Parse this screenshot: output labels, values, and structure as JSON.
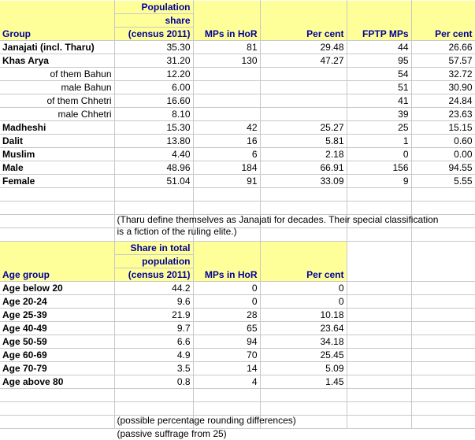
{
  "table_ethnic": {
    "headers": [
      "Group",
      "Population share\n(census 2011)",
      "MPs in HoR",
      "Per cent",
      "FPTP MPs",
      "Per cent"
    ],
    "header_parts": {
      "group": "Group",
      "population_share_l1": "Population",
      "population_share_l2": "share",
      "population_share_l3": "(census 2011)",
      "mps_in_hor": "MPs in HoR",
      "per_cent_1": "Per cent",
      "fptp_mps": "FPTP MPs",
      "per_cent_2": "Per cent"
    },
    "rows": [
      {
        "label": "Janajati (incl. Tharu)",
        "style": "bold",
        "pop_share": "35.30",
        "mps_hor": "81",
        "pct_hor": "29.48",
        "fptp": "44",
        "pct_fptp": "26.66"
      },
      {
        "label": "Khas Arya",
        "style": "bold",
        "pop_share": "31.20",
        "mps_hor": "130",
        "pct_hor": "47.27",
        "fptp": "95",
        "pct_fptp": "57.57"
      },
      {
        "label": "of them Bahun",
        "style": "indent",
        "pop_share": "12.20",
        "mps_hor": "",
        "pct_hor": "",
        "fptp": "54",
        "pct_fptp": "32.72"
      },
      {
        "label": "male Bahun",
        "style": "indent",
        "pop_share": "6.00",
        "mps_hor": "",
        "pct_hor": "",
        "fptp": "51",
        "pct_fptp": "30.90"
      },
      {
        "label": "of them Chhetri",
        "style": "indent",
        "pop_share": "16.60",
        "mps_hor": "",
        "pct_hor": "",
        "fptp": "41",
        "pct_fptp": "24.84"
      },
      {
        "label": "male Chhetri",
        "style": "indent",
        "pop_share": "8.10",
        "mps_hor": "",
        "pct_hor": "",
        "fptp": "39",
        "pct_fptp": "23.63"
      },
      {
        "label": "Madheshi",
        "style": "bold",
        "pop_share": "15.30",
        "mps_hor": "42",
        "pct_hor": "25.27",
        "fptp": "25",
        "pct_fptp": "15.15"
      },
      {
        "label": "Dalit",
        "style": "bold",
        "pop_share": "13.80",
        "mps_hor": "16",
        "pct_hor": "5.81",
        "fptp": "1",
        "pct_fptp": "0.60"
      },
      {
        "label": "Muslim",
        "style": "bold",
        "pop_share": "4.40",
        "mps_hor": "6",
        "pct_hor": "2.18",
        "fptp": "0",
        "pct_fptp": "0.00"
      },
      {
        "label": "Male",
        "style": "bold",
        "pop_share": "48.96",
        "mps_hor": "184",
        "pct_hor": "66.91",
        "fptp": "156",
        "pct_fptp": "94.55"
      },
      {
        "label": "Female",
        "style": "bold",
        "pop_share": "51.04",
        "mps_hor": "91",
        "pct_hor": "33.09",
        "fptp": "9",
        "pct_fptp": "5.55"
      }
    ]
  },
  "note_tharu": "(Tharu define themselves as Janajati for decades. Their special classification\nis a fiction of the ruling elite.)",
  "table_age": {
    "header_parts": {
      "age_group": "Age group",
      "share_l1": "Share in total",
      "share_l2": "population",
      "share_l3": "(census 2011)",
      "mps_in_hor": "MPs in HoR",
      "per_cent": "Per cent"
    },
    "rows": [
      {
        "label": "Age  below 20",
        "pop_share": "44.2",
        "mps_hor": "0",
        "pct_hor": "0"
      },
      {
        "label": "Age 20-24",
        "pop_share": "9.6",
        "mps_hor": "0",
        "pct_hor": "0"
      },
      {
        "label": "Age 25-39",
        "pop_share": "21.9",
        "mps_hor": "28",
        "pct_hor": "10.18"
      },
      {
        "label": "Age 40-49",
        "pop_share": "9.7",
        "mps_hor": "65",
        "pct_hor": "23.64"
      },
      {
        "label": "Age 50-59",
        "pop_share": "6.6",
        "mps_hor": "94",
        "pct_hor": "34.18"
      },
      {
        "label": "Age 60-69",
        "pop_share": "4.9",
        "mps_hor": "70",
        "pct_hor": "25.45"
      },
      {
        "label": "Age 70-79",
        "pop_share": "3.5",
        "mps_hor": "14",
        "pct_hor": "5.09"
      },
      {
        "label": "Age above 80",
        "pop_share": "0.8",
        "mps_hor": "4",
        "pct_hor": "1.45"
      }
    ]
  },
  "footnotes": {
    "rounding": "(possible percentage rounding differences)",
    "suffrage": "(passive suffrage from 25)"
  },
  "colors": {
    "header_fill": "#ffff99",
    "header_text": "#000099",
    "grid": "#c8c8c8",
    "border_strong": "#000000"
  }
}
